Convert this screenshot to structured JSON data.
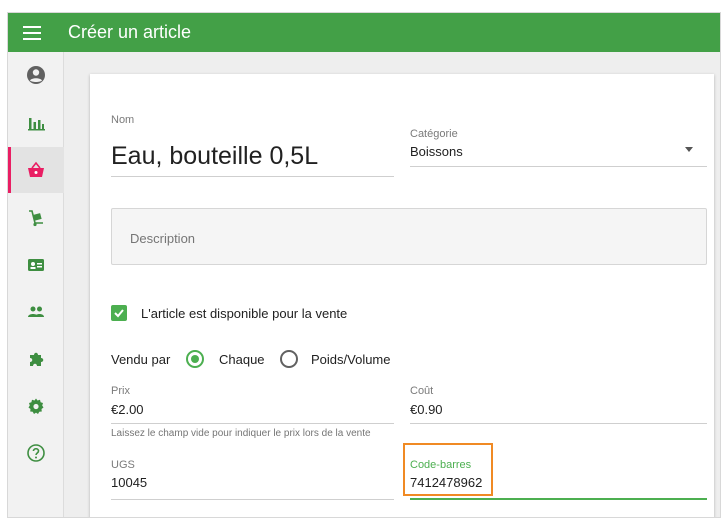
{
  "appbar": {
    "title": "Créer un article",
    "menu_icon": "menu-icon",
    "color": "#43a047"
  },
  "sidebar": {
    "items": [
      {
        "icon": "account-circle-icon",
        "active": false
      },
      {
        "icon": "bar-chart-icon",
        "active": false
      },
      {
        "icon": "basket-icon",
        "active": true
      },
      {
        "icon": "dolly-icon",
        "active": false
      },
      {
        "icon": "id-card-icon",
        "active": false
      },
      {
        "icon": "people-icon",
        "active": false
      },
      {
        "icon": "puzzle-icon",
        "active": false
      },
      {
        "icon": "gear-icon",
        "active": false
      },
      {
        "icon": "help-circle-icon",
        "active": false
      }
    ],
    "active_color": "#e91e63",
    "icon_color": "#3e8e41"
  },
  "form": {
    "name_label": "Nom",
    "name_value": "Eau, bouteille 0,5L",
    "category_label": "Catégorie",
    "category_value": "Boissons",
    "description_placeholder": "Description",
    "available_label": "L'article est disponible pour la vente",
    "available_checked": true,
    "sold_by_label": "Vendu par",
    "sold_by_options": [
      "Chaque",
      "Poids/Volume"
    ],
    "sold_by_selected": "Chaque",
    "price_label": "Prix",
    "price_value": "€2.00",
    "price_helper": "Laissez le champ vide pour indiquer le prix lors de la vente",
    "cost_label": "Coût",
    "cost_value": "€0.90",
    "sku_label": "UGS",
    "sku_value": "10045",
    "barcode_label": "Code-barres",
    "barcode_value": "7412478962",
    "accent": "#4caf50",
    "highlight": "#f08a24"
  }
}
